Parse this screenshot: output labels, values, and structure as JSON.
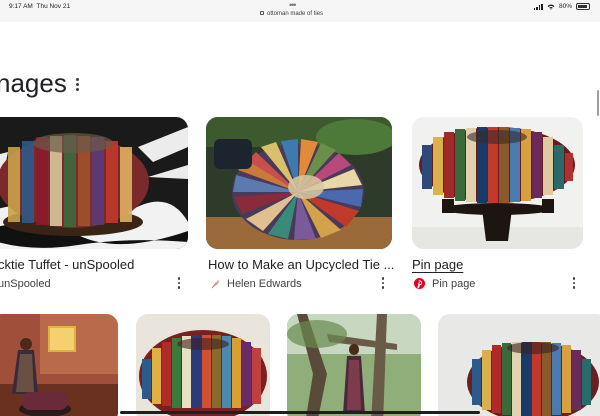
{
  "status_bar": {
    "time": "9:17 AM",
    "date": "Thu Nov 21",
    "url": "ottoman made of ties",
    "battery": "80%"
  },
  "section": {
    "heading": "nages"
  },
  "results": [
    {
      "title": "cktie Tuffet - unSpooled",
      "source": "unSpooled"
    },
    {
      "title": "How to Make an Upcycled Tie ...",
      "source": "Helen Edwards"
    },
    {
      "title": "Pin page",
      "source": "Pin page"
    }
  ],
  "colors": {
    "pinterest_red": "#e60023",
    "text": "#202124",
    "muted": "#3c4043"
  },
  "icons": {
    "more": "vertical-ellipsis",
    "pinterest": "pinterest-logo",
    "source_favicon": "feather-icon"
  }
}
